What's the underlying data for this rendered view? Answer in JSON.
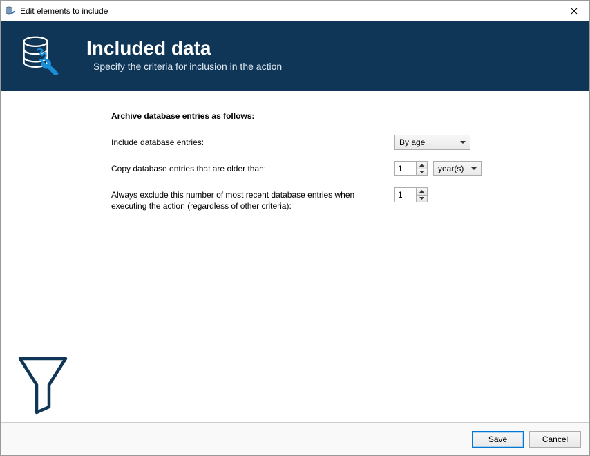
{
  "window": {
    "title": "Edit elements to include"
  },
  "banner": {
    "heading": "Included data",
    "subheading": "Specify the criteria for inclusion in the action"
  },
  "form": {
    "section_heading": "Archive database entries as follows:",
    "include_label": "Include database entries:",
    "include_value": "By age",
    "older_than_label": "Copy database entries that are older than:",
    "older_than_value": "1",
    "older_than_unit": "year(s)",
    "exclude_label": "Always exclude this number of most recent database entries when executing the action (regardless of other criteria):",
    "exclude_value": "1"
  },
  "footer": {
    "save": "Save",
    "cancel": "Cancel"
  }
}
